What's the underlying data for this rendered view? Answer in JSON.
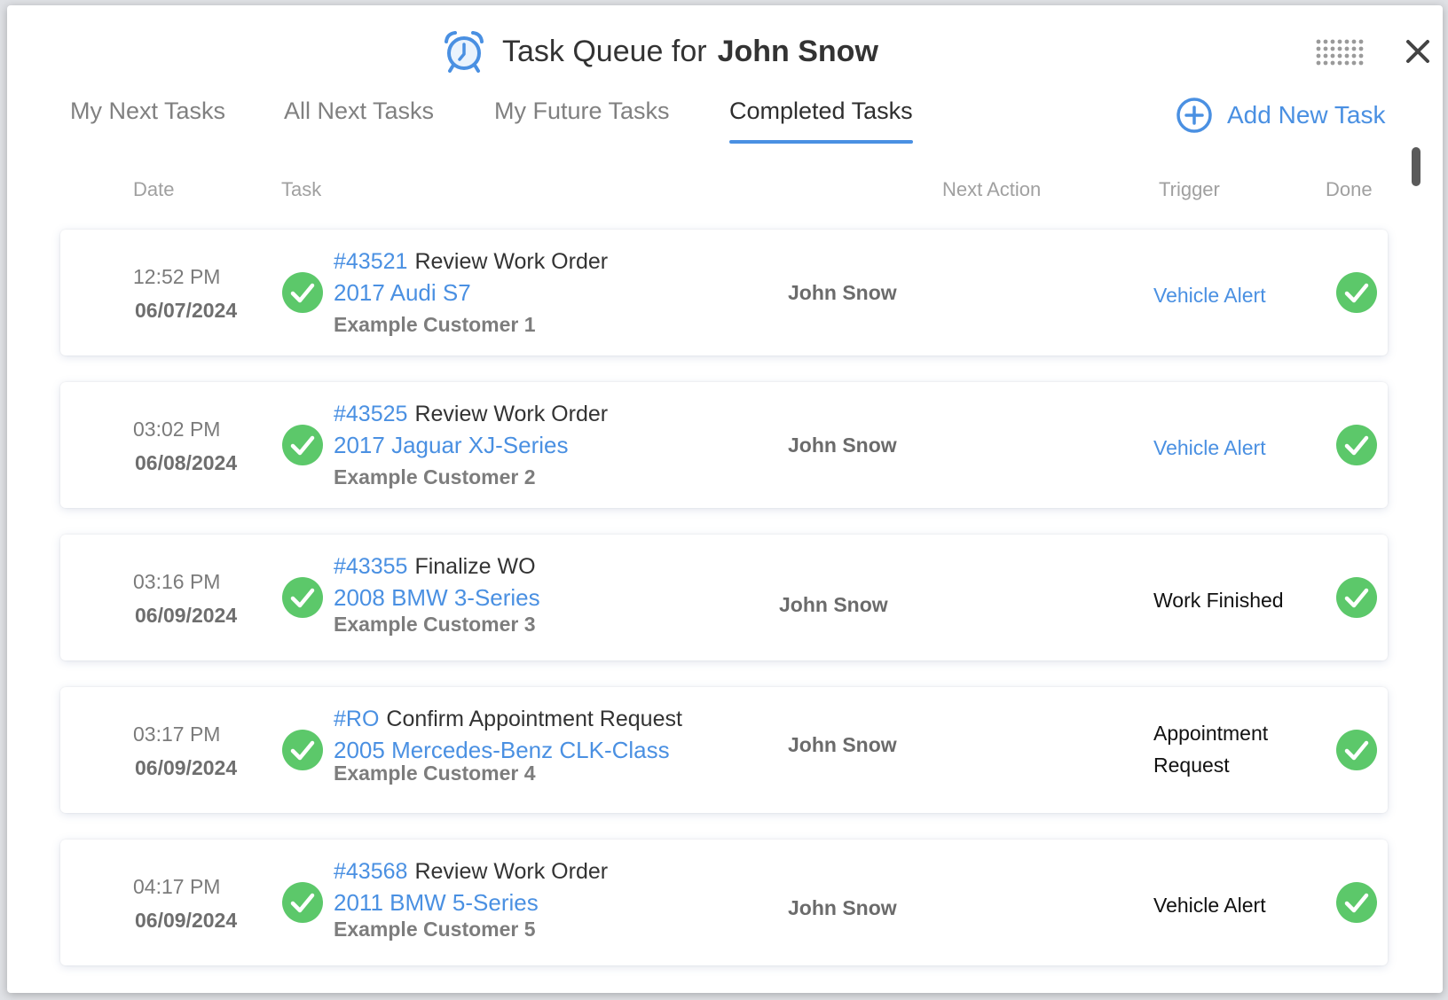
{
  "header": {
    "title_prefix": "Task Queue for",
    "title_name": "John Snow"
  },
  "tabs": [
    {
      "label": "My Next Tasks",
      "active": false
    },
    {
      "label": "All Next Tasks",
      "active": false
    },
    {
      "label": "My Future Tasks",
      "active": false
    },
    {
      "label": "Completed Tasks",
      "active": true
    }
  ],
  "add_task_label": "Add New Task",
  "columns": {
    "date": "Date",
    "task": "Task",
    "next_action": "Next Action",
    "trigger": "Trigger",
    "done": "Done"
  },
  "colors": {
    "accent": "#4a90e2",
    "done_green": "#5cc86a"
  },
  "tasks": [
    {
      "time": "12:52 PM",
      "date": "06/07/2024",
      "wo": "#43521",
      "title": "Review Work Order",
      "vehicle": "2017 Audi S7",
      "customer": "Example Customer 1",
      "next_action": "John Snow",
      "trigger_line1": "Vehicle Alert",
      "trigger_line2": "",
      "trigger_link": true
    },
    {
      "time": "03:02 PM",
      "date": "06/08/2024",
      "wo": "#43525",
      "title": "Review Work Order",
      "vehicle": "2017 Jaguar XJ-Series",
      "customer": "Example Customer 2",
      "next_action": "John Snow",
      "trigger_line1": "Vehicle Alert",
      "trigger_line2": "",
      "trigger_link": true
    },
    {
      "time": "03:16 PM",
      "date": "06/09/2024",
      "wo": "#43355",
      "title": "Finalize WO",
      "vehicle": "2008 BMW 3-Series",
      "customer": "Example Customer 3",
      "next_action": "John Snow",
      "trigger_line1": "Work Finished",
      "trigger_line2": "",
      "trigger_link": false
    },
    {
      "time": "03:17 PM",
      "date": "06/09/2024",
      "wo": "#RO",
      "title": "Confirm Appointment Request",
      "vehicle": "2005 Mercedes-Benz CLK-Class",
      "customer": "Example Customer 4",
      "next_action": "John Snow",
      "trigger_line1": "Appointment",
      "trigger_line2": "Request",
      "trigger_link": false
    },
    {
      "time": "04:17 PM",
      "date": "06/09/2024",
      "wo": "#43568",
      "title": "Review Work Order",
      "vehicle": "2011 BMW 5-Series",
      "customer": "Example Customer 5",
      "next_action": "John Snow",
      "trigger_line1": "Vehicle Alert",
      "trigger_line2": "",
      "trigger_link": false
    }
  ]
}
